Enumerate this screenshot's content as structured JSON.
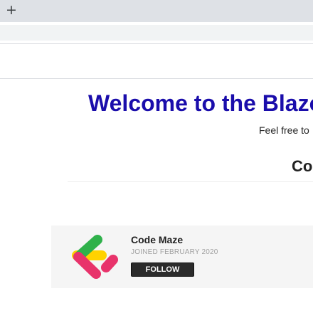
{
  "browser": {
    "new_tab_glyph": "+",
    "new_tab_icon": "plus-icon"
  },
  "page": {
    "hero_title": "Welcome to the Blazo",
    "hero_subtitle": "Feel free to",
    "section_title": "Co",
    "accent_color": "#1a0dab"
  },
  "card": {
    "name": "Code Maze",
    "joined": "JOINED FEBRUARY 2020",
    "follow_label": "FOLLOW",
    "logo_icon": "code-maze-logo",
    "logo_colors": [
      "#e8336b",
      "#ffd200",
      "#2fb14b"
    ]
  }
}
